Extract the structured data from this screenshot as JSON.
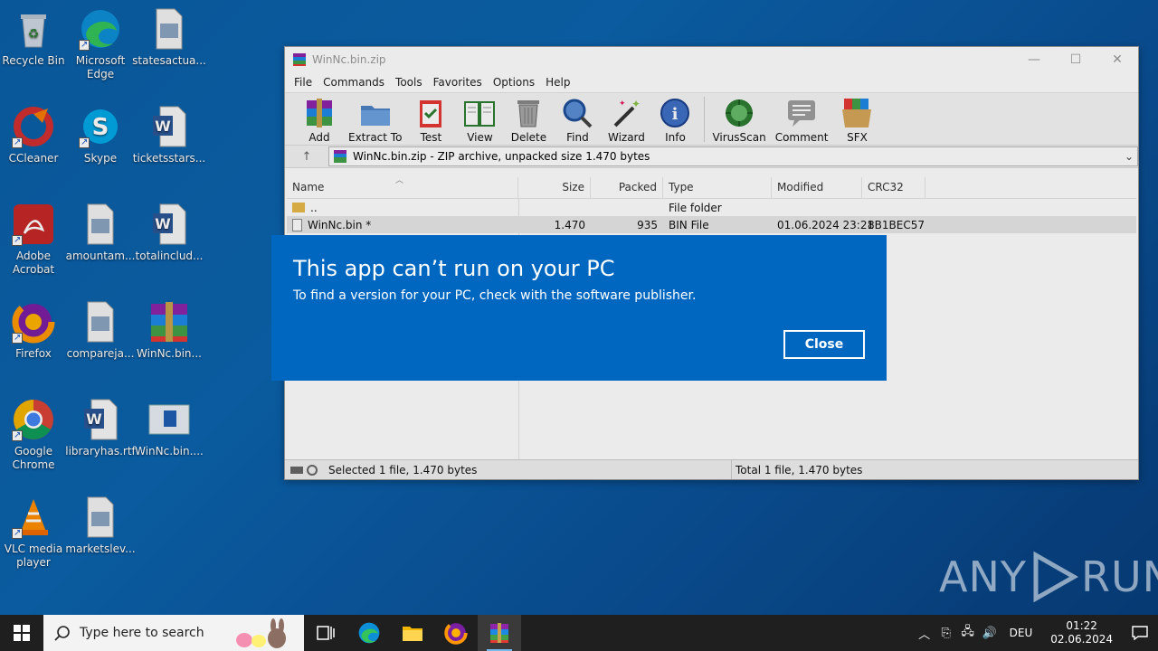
{
  "desktop": {
    "icons": [
      {
        "label": "Recycle Bin",
        "icon": "recycle-bin-icon"
      },
      {
        "label": "Microsoft Edge",
        "icon": "edge-icon"
      },
      {
        "label": "statesactua...",
        "icon": "image-file-icon"
      },
      {
        "label": "CCleaner",
        "icon": "ccleaner-icon"
      },
      {
        "label": "Skype",
        "icon": "skype-icon"
      },
      {
        "label": "ticketsstars...",
        "icon": "word-doc-icon"
      },
      {
        "label": "Adobe Acrobat",
        "icon": "acrobat-icon"
      },
      {
        "label": "amountam...",
        "icon": "image-file-icon"
      },
      {
        "label": "totalinclud...",
        "icon": "word-doc-icon"
      },
      {
        "label": "Firefox",
        "icon": "firefox-icon"
      },
      {
        "label": "compareja...",
        "icon": "image-file-icon"
      },
      {
        "label": "WinNc.bin...",
        "icon": "winrar-icon"
      },
      {
        "label": "Google Chrome",
        "icon": "chrome-icon"
      },
      {
        "label": "libraryhas.rtf",
        "icon": "word-doc-icon"
      },
      {
        "label": "WinNc.bin....",
        "icon": "window-file-icon"
      },
      {
        "label": "VLC media player",
        "icon": "vlc-icon"
      },
      {
        "label": "marketslev...",
        "icon": "image-file-icon"
      }
    ]
  },
  "window": {
    "title": "WinNc.bin.zip",
    "menu": [
      "File",
      "Commands",
      "Tools",
      "Favorites",
      "Options",
      "Help"
    ],
    "toolbar": [
      "Add",
      "Extract To",
      "Test",
      "View",
      "Delete",
      "Find",
      "Wizard",
      "Info",
      "VirusScan",
      "Comment",
      "SFX"
    ],
    "address": "WinNc.bin.zip - ZIP archive, unpacked size 1.470 bytes",
    "columns": [
      "Name",
      "Size",
      "Packed",
      "Type",
      "Modified",
      "CRC32"
    ],
    "rows": [
      {
        "name": "..",
        "size": "",
        "packed": "",
        "type": "File folder",
        "modified": "",
        "crc": ""
      },
      {
        "name": "WinNc.bin *",
        "size": "1.470",
        "packed": "935",
        "type": "BIN File",
        "modified": "01.06.2024 23:21",
        "crc": "8B1BEC57"
      }
    ],
    "status_left": "Selected 1 file, 1.470 bytes",
    "status_right": "Total 1 file, 1.470 bytes"
  },
  "dialog": {
    "title": "This app can’t run on your PC",
    "message": "To find a version for your PC, check with the software publisher.",
    "close_label": "Close"
  },
  "watermark": {
    "left": "ANY",
    "right": "RUN"
  },
  "taskbar": {
    "search_placeholder": "Type here to search",
    "lang": "DEU",
    "time": "01:22",
    "date": "02.06.2024"
  },
  "colors": {
    "dialog": "#0067c0",
    "taskbar": "#1f1f1f",
    "desktop": "#0a5fa6"
  }
}
